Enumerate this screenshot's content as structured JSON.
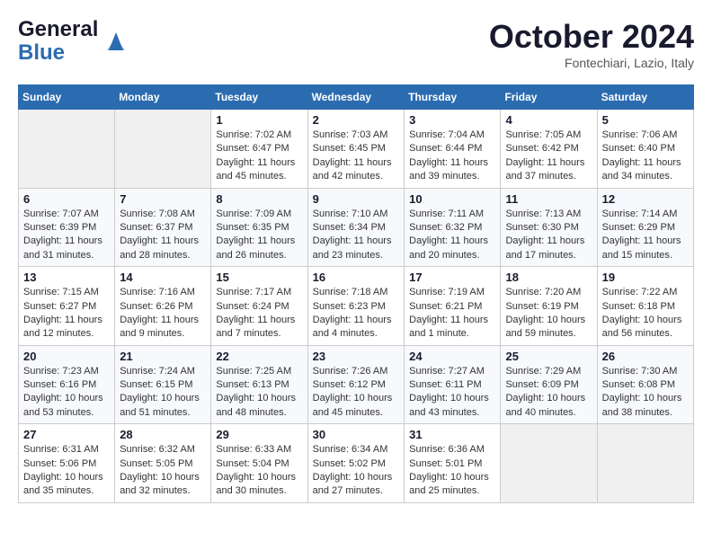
{
  "header": {
    "logo_general": "General",
    "logo_blue": "Blue",
    "month_title": "October 2024",
    "location": "Fontechiari, Lazio, Italy"
  },
  "days_of_week": [
    "Sunday",
    "Monday",
    "Tuesday",
    "Wednesday",
    "Thursday",
    "Friday",
    "Saturday"
  ],
  "weeks": [
    [
      {
        "day": "",
        "info": ""
      },
      {
        "day": "",
        "info": ""
      },
      {
        "day": "1",
        "info": "Sunrise: 7:02 AM\nSunset: 6:47 PM\nDaylight: 11 hours and 45 minutes."
      },
      {
        "day": "2",
        "info": "Sunrise: 7:03 AM\nSunset: 6:45 PM\nDaylight: 11 hours and 42 minutes."
      },
      {
        "day": "3",
        "info": "Sunrise: 7:04 AM\nSunset: 6:44 PM\nDaylight: 11 hours and 39 minutes."
      },
      {
        "day": "4",
        "info": "Sunrise: 7:05 AM\nSunset: 6:42 PM\nDaylight: 11 hours and 37 minutes."
      },
      {
        "day": "5",
        "info": "Sunrise: 7:06 AM\nSunset: 6:40 PM\nDaylight: 11 hours and 34 minutes."
      }
    ],
    [
      {
        "day": "6",
        "info": "Sunrise: 7:07 AM\nSunset: 6:39 PM\nDaylight: 11 hours and 31 minutes."
      },
      {
        "day": "7",
        "info": "Sunrise: 7:08 AM\nSunset: 6:37 PM\nDaylight: 11 hours and 28 minutes."
      },
      {
        "day": "8",
        "info": "Sunrise: 7:09 AM\nSunset: 6:35 PM\nDaylight: 11 hours and 26 minutes."
      },
      {
        "day": "9",
        "info": "Sunrise: 7:10 AM\nSunset: 6:34 PM\nDaylight: 11 hours and 23 minutes."
      },
      {
        "day": "10",
        "info": "Sunrise: 7:11 AM\nSunset: 6:32 PM\nDaylight: 11 hours and 20 minutes."
      },
      {
        "day": "11",
        "info": "Sunrise: 7:13 AM\nSunset: 6:30 PM\nDaylight: 11 hours and 17 minutes."
      },
      {
        "day": "12",
        "info": "Sunrise: 7:14 AM\nSunset: 6:29 PM\nDaylight: 11 hours and 15 minutes."
      }
    ],
    [
      {
        "day": "13",
        "info": "Sunrise: 7:15 AM\nSunset: 6:27 PM\nDaylight: 11 hours and 12 minutes."
      },
      {
        "day": "14",
        "info": "Sunrise: 7:16 AM\nSunset: 6:26 PM\nDaylight: 11 hours and 9 minutes."
      },
      {
        "day": "15",
        "info": "Sunrise: 7:17 AM\nSunset: 6:24 PM\nDaylight: 11 hours and 7 minutes."
      },
      {
        "day": "16",
        "info": "Sunrise: 7:18 AM\nSunset: 6:23 PM\nDaylight: 11 hours and 4 minutes."
      },
      {
        "day": "17",
        "info": "Sunrise: 7:19 AM\nSunset: 6:21 PM\nDaylight: 11 hours and 1 minute."
      },
      {
        "day": "18",
        "info": "Sunrise: 7:20 AM\nSunset: 6:19 PM\nDaylight: 10 hours and 59 minutes."
      },
      {
        "day": "19",
        "info": "Sunrise: 7:22 AM\nSunset: 6:18 PM\nDaylight: 10 hours and 56 minutes."
      }
    ],
    [
      {
        "day": "20",
        "info": "Sunrise: 7:23 AM\nSunset: 6:16 PM\nDaylight: 10 hours and 53 minutes."
      },
      {
        "day": "21",
        "info": "Sunrise: 7:24 AM\nSunset: 6:15 PM\nDaylight: 10 hours and 51 minutes."
      },
      {
        "day": "22",
        "info": "Sunrise: 7:25 AM\nSunset: 6:13 PM\nDaylight: 10 hours and 48 minutes."
      },
      {
        "day": "23",
        "info": "Sunrise: 7:26 AM\nSunset: 6:12 PM\nDaylight: 10 hours and 45 minutes."
      },
      {
        "day": "24",
        "info": "Sunrise: 7:27 AM\nSunset: 6:11 PM\nDaylight: 10 hours and 43 minutes."
      },
      {
        "day": "25",
        "info": "Sunrise: 7:29 AM\nSunset: 6:09 PM\nDaylight: 10 hours and 40 minutes."
      },
      {
        "day": "26",
        "info": "Sunrise: 7:30 AM\nSunset: 6:08 PM\nDaylight: 10 hours and 38 minutes."
      }
    ],
    [
      {
        "day": "27",
        "info": "Sunrise: 6:31 AM\nSunset: 5:06 PM\nDaylight: 10 hours and 35 minutes."
      },
      {
        "day": "28",
        "info": "Sunrise: 6:32 AM\nSunset: 5:05 PM\nDaylight: 10 hours and 32 minutes."
      },
      {
        "day": "29",
        "info": "Sunrise: 6:33 AM\nSunset: 5:04 PM\nDaylight: 10 hours and 30 minutes."
      },
      {
        "day": "30",
        "info": "Sunrise: 6:34 AM\nSunset: 5:02 PM\nDaylight: 10 hours and 27 minutes."
      },
      {
        "day": "31",
        "info": "Sunrise: 6:36 AM\nSunset: 5:01 PM\nDaylight: 10 hours and 25 minutes."
      },
      {
        "day": "",
        "info": ""
      },
      {
        "day": "",
        "info": ""
      }
    ]
  ]
}
